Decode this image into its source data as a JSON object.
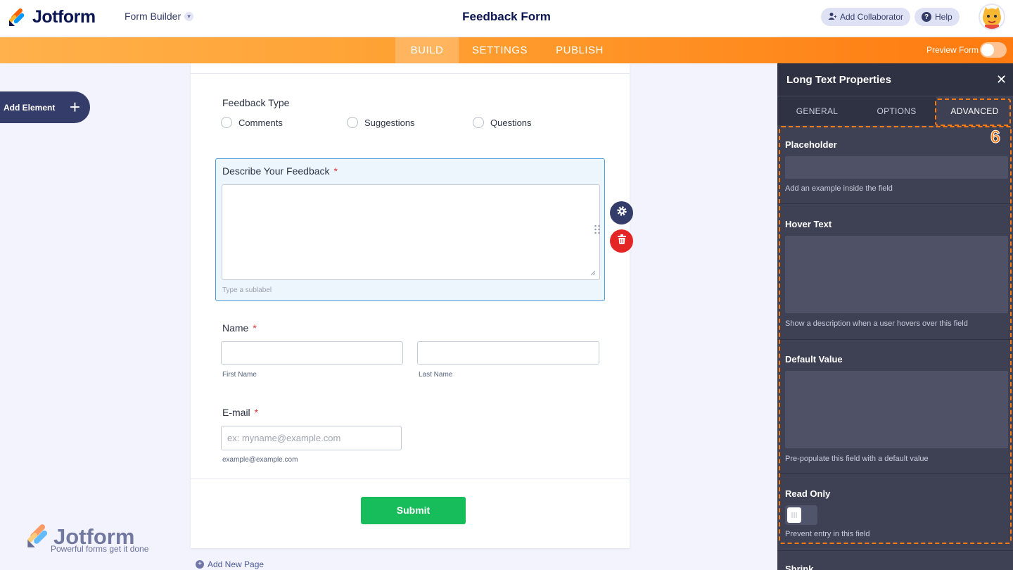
{
  "header": {
    "brand": "Jotform",
    "builder_select": "Form Builder",
    "form_title": "Feedback Form",
    "add_collaborator": "Add Collaborator",
    "help": "Help"
  },
  "nav": {
    "tabs": [
      "BUILD",
      "SETTINGS",
      "PUBLISH"
    ],
    "active_tab": "BUILD",
    "preview_label": "Preview Form",
    "preview_on": false
  },
  "sidebar": {
    "add_element": "Add Element"
  },
  "form": {
    "feedback_type": {
      "label": "Feedback Type",
      "options": [
        "Comments",
        "Suggestions",
        "Questions"
      ]
    },
    "describe": {
      "label": "Describe Your Feedback",
      "required_mark": "*",
      "sublabel_placeholder": "Type a sublabel"
    },
    "name": {
      "label": "Name",
      "required_mark": "*",
      "first_sublabel": "First Name",
      "last_sublabel": "Last Name"
    },
    "email": {
      "label": "E-mail",
      "required_mark": "*",
      "placeholder": "ex: myname@example.com",
      "sublabel": "example@example.com"
    },
    "submit": "Submit",
    "add_new_page": "Add New Page"
  },
  "watermark": {
    "brand": "Jotform",
    "tagline": "Powerful forms get it done"
  },
  "panel": {
    "title": "Long Text Properties",
    "tabs": [
      "GENERAL",
      "OPTIONS",
      "ADVANCED"
    ],
    "active_tab": "ADVANCED",
    "step_number": "6",
    "sections": {
      "placeholder": {
        "label": "Placeholder",
        "help": "Add an example inside the field"
      },
      "hover_text": {
        "label": "Hover Text",
        "help": "Show a description when a user hovers over this field"
      },
      "default_value": {
        "label": "Default Value",
        "help": "Pre-populate this field with a default value"
      },
      "read_only": {
        "label": "Read Only",
        "help": "Prevent entry in this field",
        "enabled": false
      },
      "shrink": {
        "label": "Shrink"
      }
    }
  },
  "colors": {
    "brand_navy": "#0a1551",
    "nav_orange": "#ff7a0f",
    "submit_green": "#18bd5b",
    "delete_red": "#e42525",
    "panel_bg": "#3e4153"
  }
}
